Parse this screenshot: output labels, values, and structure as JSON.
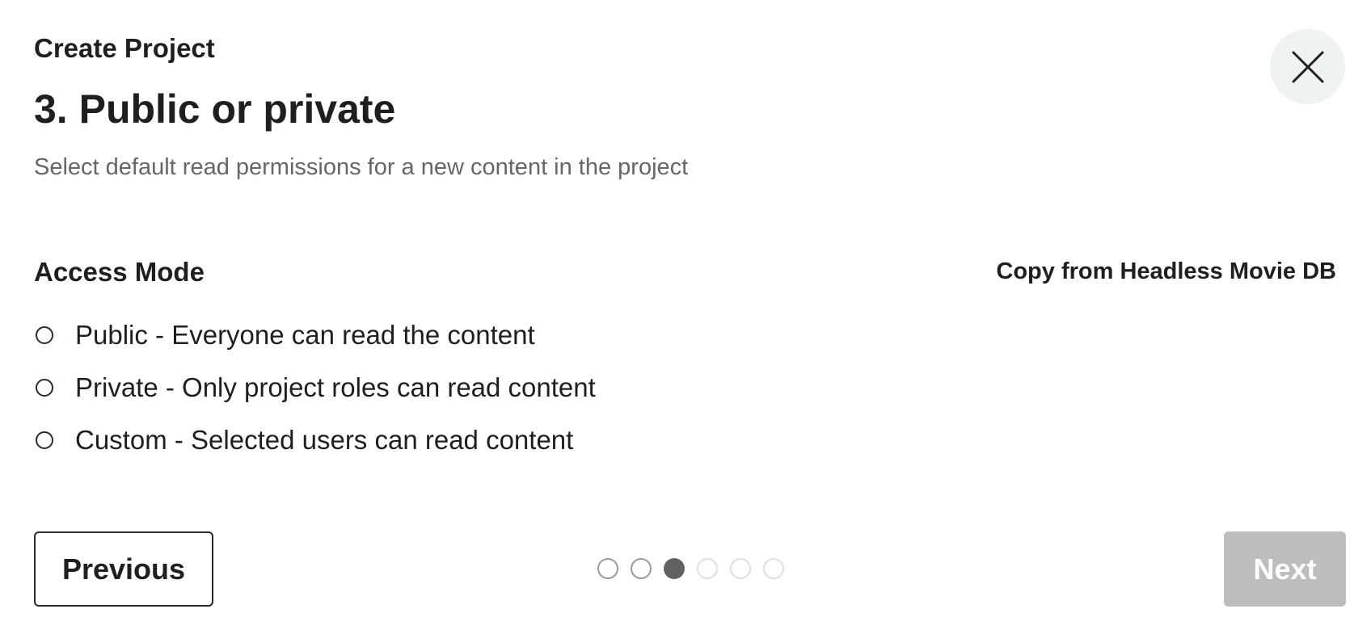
{
  "dialog": {
    "eyebrow": "Create Project",
    "title": "3. Public or private",
    "subtitle": "Select default read permissions for a new content in the project",
    "close_icon": "close-icon"
  },
  "access": {
    "label": "Access Mode",
    "copy_link": "Copy from Headless Movie DB",
    "options": [
      {
        "label": "Public - Everyone can read the content",
        "selected": false
      },
      {
        "label": "Private - Only project roles can read content",
        "selected": false
      },
      {
        "label": "Custom - Selected users can read content",
        "selected": false
      }
    ]
  },
  "footer": {
    "previous_label": "Previous",
    "next_label": "Next",
    "next_disabled": true,
    "steps_total": 6,
    "current_step": 3
  },
  "colors": {
    "close_bg": "#eef2f2",
    "next_disabled_bg": "#bdbdbd",
    "step_current": "#616161",
    "step_done_border": "#9a9a9a",
    "step_upcoming_border": "#dedede",
    "subtitle_text": "#666666"
  }
}
